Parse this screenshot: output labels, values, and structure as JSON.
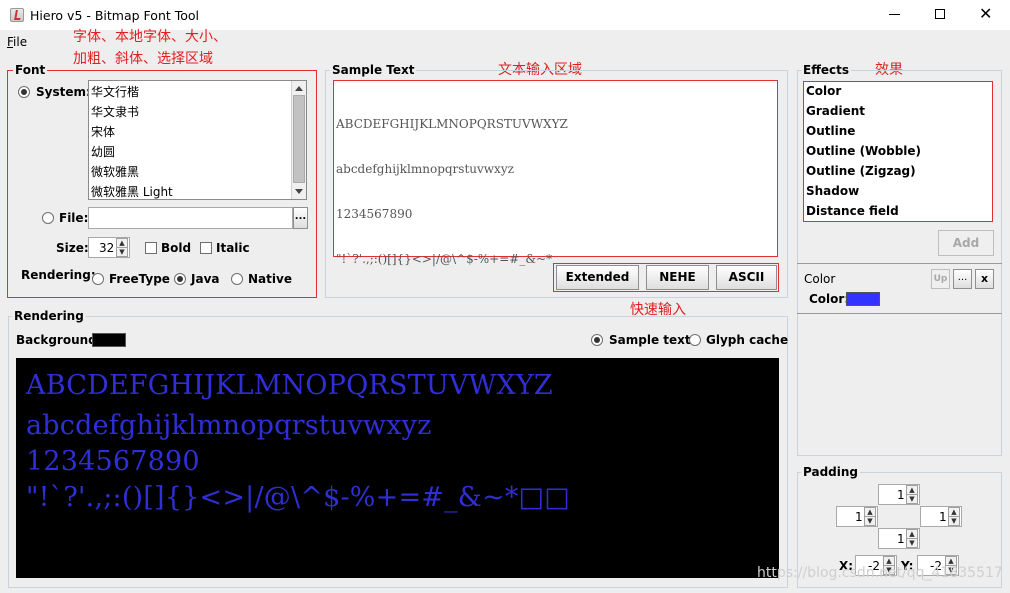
{
  "window": {
    "title": "Hiero v5 - Bitmap Font Tool",
    "controls": {
      "minimize": "─",
      "maximize": "☐",
      "close": "✕"
    }
  },
  "menu": {
    "file": "File"
  },
  "annotations": {
    "font_area_line1": "字体、本地字体、大小、",
    "font_area_line2": "加粗、斜体、选择区域",
    "text_input": "文本输入区域",
    "effects": "效果",
    "quick_input": "快速输入"
  },
  "font_panel": {
    "title": "Font",
    "system_label": "System:",
    "system_selected": true,
    "fonts": [
      "华文行楷",
      "华文隶书",
      "宋体",
      "幼圆",
      "微软雅黑",
      "微软雅黑 Light"
    ],
    "file_label": "File:",
    "file_value": "",
    "browse_label": "...",
    "size_label": "Size:",
    "size_value": "32",
    "bold_label": "Bold",
    "bold_checked": false,
    "italic_label": "Italic",
    "italic_checked": false,
    "rendering_label": "Rendering:",
    "rendering_options": [
      "FreeType",
      "Java",
      "Native"
    ],
    "rendering_selected": "Java"
  },
  "sample_text": {
    "title": "Sample Text",
    "lines": [
      "ABCDEFGHIJKLMNOPQRSTUVWXYZ",
      "abcdefghijklmnopqrstuvwxyz",
      "1234567890",
      "\"!`?'.,;:()[]{}<>|/@\\^$-%+=#_&~*"
    ],
    "buttons": [
      "Extended",
      "NEHE",
      "ASCII"
    ]
  },
  "effects_panel": {
    "title": "Effects",
    "items": [
      "Color",
      "Gradient",
      "Outline",
      "Outline (Wobble)",
      "Outline (Zigzag)",
      "Shadow",
      "Distance field"
    ],
    "add_label": "Add",
    "selected_effect": {
      "name": "Color",
      "up_label": "Up",
      "more_label": "...",
      "remove_label": "x",
      "color_label": "Color:",
      "color_value": "#3333ff"
    }
  },
  "rendering_panel": {
    "title": "Rendering",
    "background_label": "Background:",
    "background_color": "#000000",
    "view_options": [
      "Sample text",
      "Glyph cache"
    ],
    "view_selected": "Sample text",
    "preview_lines": [
      "ABCDEFGHIJKLMNOPQRSTUVWXYZ",
      "abcdefghijklmnopqrstuvwxyz",
      "1234567890",
      "\"!`?'.,;:()[]{}<>|/@\\^$-%+=#_&~*□□"
    ],
    "text_color": "#2f2fd8"
  },
  "padding_panel": {
    "title": "Padding",
    "top": "1",
    "left": "1",
    "right": "1",
    "bottom": "1",
    "x_label": "X:",
    "x_value": "-2",
    "y_label": "Y:",
    "y_value": "-2"
  },
  "watermark": "https://blog.csdn.net/qq_41835517"
}
